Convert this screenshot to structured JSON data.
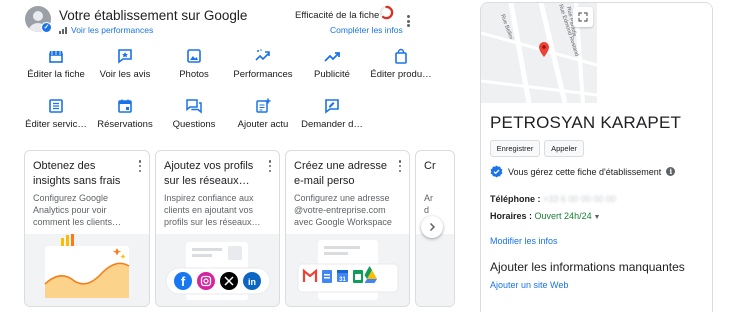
{
  "header": {
    "business_title": "Votre établissement sur Google",
    "performance_link": "Voir les performances",
    "efficiency_label": "Efficacité de la fiche",
    "complete_link": "Compléter les infos",
    "efficiency_ring_fill": 0.6
  },
  "actions": [
    {
      "label": "Éditer la fiche",
      "icon": "storefront-icon"
    },
    {
      "label": "Voir les avis",
      "icon": "reviews-icon"
    },
    {
      "label": "Photos",
      "icon": "photo-icon"
    },
    {
      "label": "Performances",
      "icon": "trending-icon"
    },
    {
      "label": "Publicité",
      "icon": "ads-trend-icon"
    },
    {
      "label": "Éditer produ…",
      "icon": "shopping-bag-icon"
    },
    {
      "label": "Éditer servic…",
      "icon": "service-list-icon"
    },
    {
      "label": "Réservations",
      "icon": "calendar-icon"
    },
    {
      "label": "Questions",
      "icon": "questions-icon"
    },
    {
      "label": "Ajouter actu",
      "icon": "add-post-icon"
    },
    {
      "label": "Demander d…",
      "icon": "request-review-icon"
    }
  ],
  "cards": [
    {
      "title": "Obtenez des insights sans frais",
      "body": "Configurez Google Analytics pour voir comment les clients…"
    },
    {
      "title": "Ajoutez vos profils sur les réseaux…",
      "body": "Inspirez confiance aux clients en ajoutant vos profils sur les réseaux…"
    },
    {
      "title": "Créez une adresse e-mail perso",
      "body": "Configurez une adresse @votre-entreprise.com avec Google Workspace"
    },
    {
      "title": "Cr",
      "body": "Ar\nd\nc"
    }
  ],
  "panel": {
    "business_name": "PETROSYAN KARAPET",
    "btn_route": "Enregistrer",
    "btn_call": "Appeler",
    "verified_text": "Vous gérez cette fiche d'établissement",
    "phone_label": "Téléphone :",
    "phone_value": "+33 6 00 00 00 00",
    "hours_label": "Horaires :",
    "hours_value": "Ouvert 24h/24",
    "edit_info_link": "Modifier les infos",
    "missing_title": "Ajouter les informations manquantes",
    "add_site_link": "Ajouter un site Web",
    "map_streets": [
      "Rue Bellini",
      "Rue Edmond Rostand",
      "Rue Paradis"
    ]
  },
  "colors": {
    "accent": "#1a73e8",
    "open_green": "#188038",
    "pin_red": "#ea4335"
  }
}
